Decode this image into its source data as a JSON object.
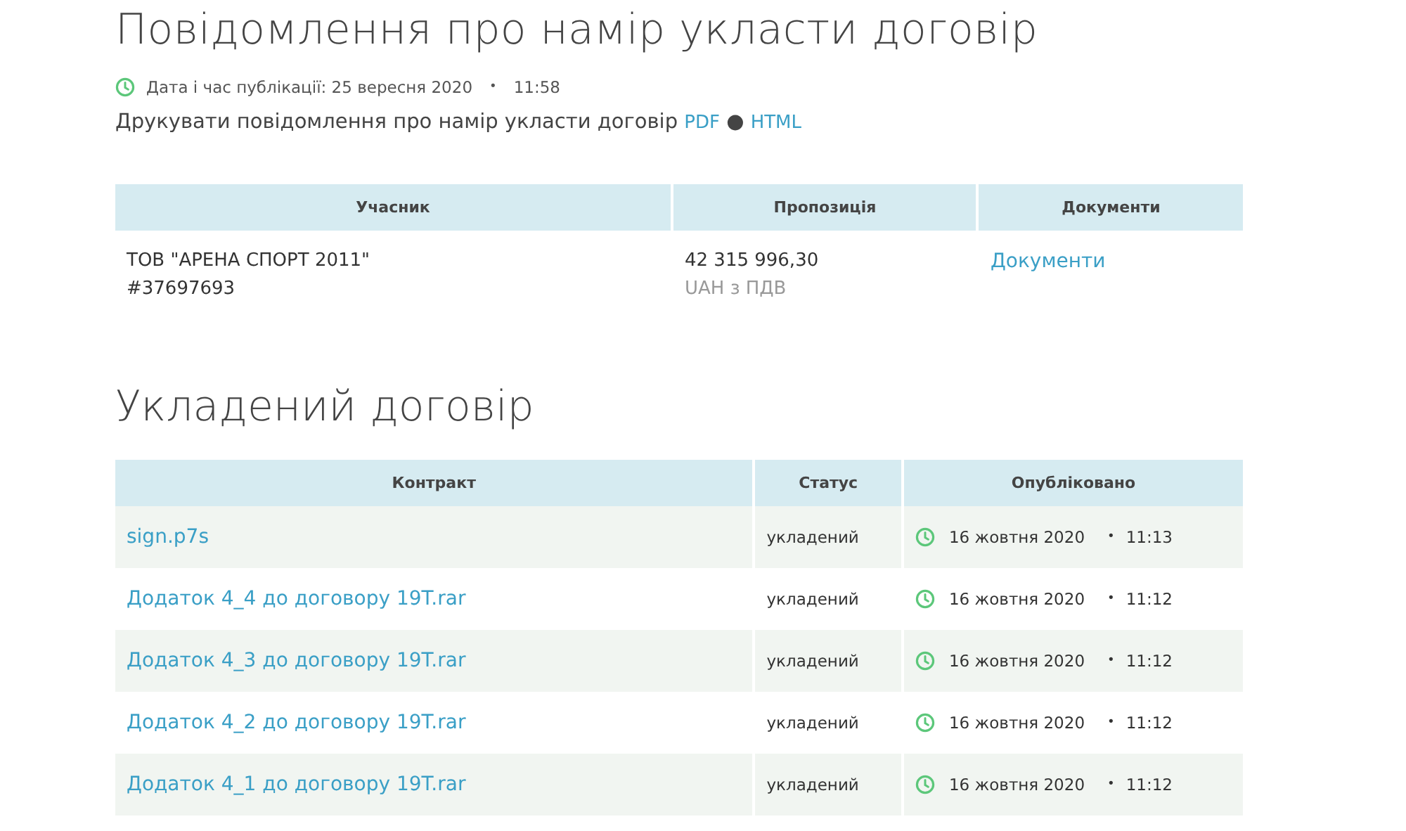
{
  "title": "Повідомлення про намір укласти договір",
  "published": {
    "label": "Дата і час публікації: 25 вересня 2020",
    "separator": "•",
    "time": "11:58"
  },
  "print": {
    "text": "Друкувати повідомлення про намір укласти договір",
    "links": [
      "PDF",
      "HTML"
    ],
    "separator": "●"
  },
  "participants": {
    "columns": [
      "Учасник",
      "Пропозиція",
      "Документи"
    ],
    "rows": [
      {
        "name": "ТОВ \"АРЕНА СПОРТ 2011\"",
        "code": "#37697693",
        "amount": "42 315 996,30",
        "currency": "UAH з ПДВ",
        "documents": "Документи"
      }
    ]
  },
  "contract": {
    "heading": "Укладений договір",
    "columns": [
      "Контракт",
      "Статус",
      "Опубліковано"
    ],
    "rows": [
      {
        "file": "sign.p7s",
        "status": "укладений",
        "date": "16 жовтня 2020",
        "separator": "•",
        "time": "11:13"
      },
      {
        "file": "Додаток 4_4 до договору 19T.rar",
        "status": "укладений",
        "date": "16 жовтня 2020",
        "separator": "•",
        "time": "11:12"
      },
      {
        "file": "Додаток 4_3 до договору 19T.rar",
        "status": "укладений",
        "date": "16 жовтня 2020",
        "separator": "•",
        "time": "11:12"
      },
      {
        "file": "Додаток 4_2 до договору 19T.rar",
        "status": "укладений",
        "date": "16 жовтня 2020",
        "separator": "•",
        "time": "11:12"
      },
      {
        "file": "Додаток 4_1 до договору 19T.rar",
        "status": "укладений",
        "date": "16 жовтня 2020",
        "separator": "•",
        "time": "11:12"
      }
    ]
  }
}
